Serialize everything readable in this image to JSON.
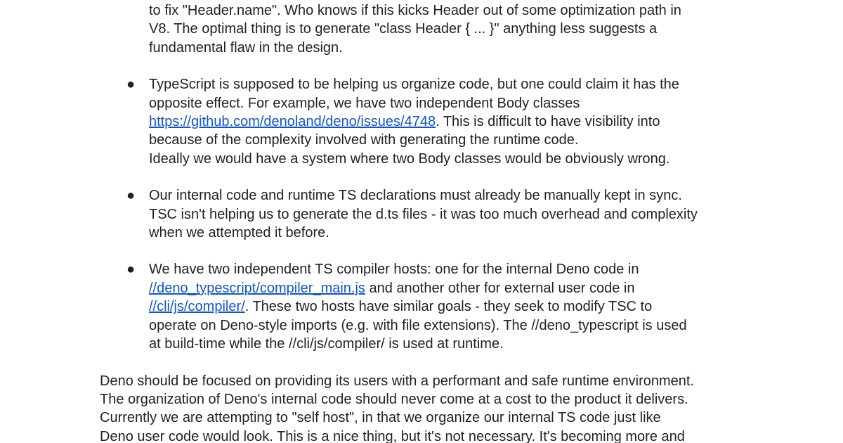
{
  "document": {
    "intro_lines": [
      "to fix \"Header.name\". Who knows if this kicks Header out of some optimization path in",
      "V8. The optimal thing is to generate \"class Header { ... }\" anything less suggests a",
      "fundamental flaw in the design."
    ],
    "bullet_glyph": "●",
    "bullet1": {
      "line1": "TypeScript is supposed to be helping us organize code, but one could claim it has the",
      "line2": "opposite effect. For example, we have two independent Body classes",
      "link": "https://github.com/denoland/deno/issues/4748",
      "line3_rest": ". This is difficult to have visibility into",
      "line4": "because of the complexity involved with generating the runtime code.",
      "line5": "Ideally we would have a system where two Body classes would be obviously wrong."
    },
    "bullet2": {
      "line1": "Our internal code and runtime TS declarations must already be manually kept in sync.",
      "line2": "TSC isn't helping us to generate the d.ts files - it was too much overhead and complexity",
      "line3": "when we attempted it before."
    },
    "bullet3": {
      "line1": "We have two independent TS compiler hosts: one for the internal Deno code in",
      "link1": "//deno_typescript/compiler_main.js",
      "line2_rest": " and another other for external user code in",
      "link2": "//cli/js/compiler/",
      "line3_rest": ". These two hosts have similar goals - they seek to modify TSC to",
      "line4": "operate on Deno-style imports (e.g. with file extensions). The //deno_typescript is used",
      "line5": "at build-time while the //cli/js/compiler/ is used at runtime."
    },
    "closing_lines": [
      "Deno should be focused on providing its users with a performant and safe runtime environment.",
      "The organization of Deno's internal code should never come at a cost to the product it delivers.",
      "Currently we are attempting to \"self host\", in that we organize our internal TS code just like",
      "Deno user code would look. This is a nice thing, but it's not necessary. It's becoming more and"
    ]
  }
}
